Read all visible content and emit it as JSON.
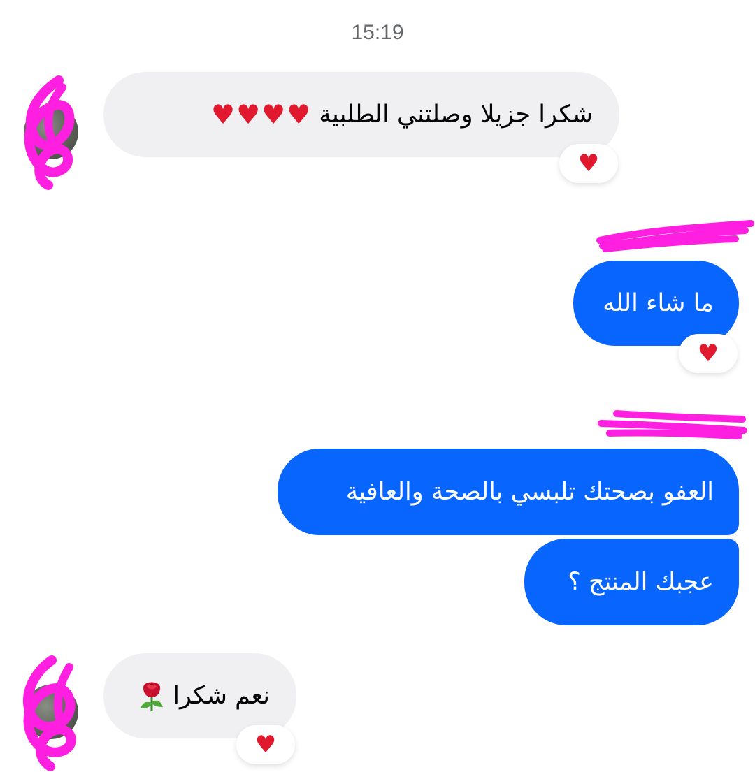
{
  "chat": {
    "timestamp": "15:19",
    "messages": [
      {
        "direction": "incoming",
        "text": "شكرا جزيلا  وصلتني الطلبية",
        "emoji": "♥♥♥♥",
        "reaction": "♥"
      },
      {
        "direction": "outgoing",
        "text": "ما شاء الله",
        "reaction": "♥"
      },
      {
        "direction": "outgoing",
        "text": "العفو بصحتك تلبسي بالصحة والعافية"
      },
      {
        "direction": "outgoing",
        "text": "عجبك المنتج ؟"
      },
      {
        "direction": "incoming",
        "text": "نعم شكرا",
        "emoji": "rose-emoji",
        "reaction": "♥"
      }
    ]
  },
  "colors": {
    "outgoing_bubble": "#0866ff",
    "incoming_bubble": "#f0f0f3",
    "reaction_heart": "#e0192e",
    "redaction_scribble": "#ff1fe0",
    "timestamp_text": "#65676b"
  },
  "icons": {
    "reaction": "heart-icon",
    "rose": "rose-emoji-icon"
  }
}
